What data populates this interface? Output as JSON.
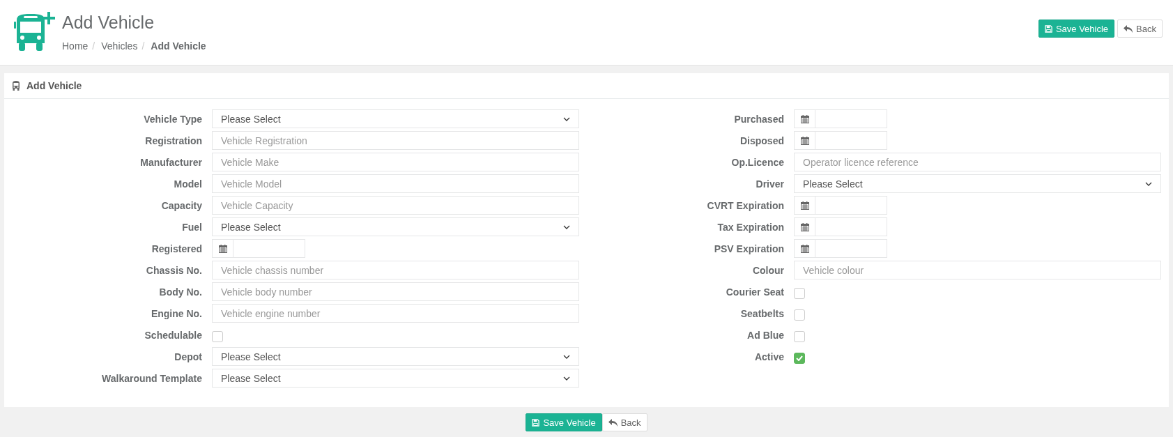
{
  "header": {
    "title": "Add Vehicle",
    "breadcrumbs": [
      {
        "label": "Home",
        "current": false
      },
      {
        "separator": "/",
        "label": "Vehicles",
        "current": false
      },
      {
        "separator": "/",
        "label": "Add Vehicle",
        "current": true
      }
    ],
    "buttons": [
      {
        "kind": "save",
        "label": "Save Vehicle"
      },
      {
        "kind": "back",
        "label": "Back"
      }
    ]
  },
  "panel": {
    "title": "Add Vehicle",
    "left_fields": [
      {
        "label": "Vehicle Type",
        "kind": "select",
        "value": "Please Select"
      },
      {
        "label": "Registration",
        "kind": "text",
        "placeholder": "Vehicle Registration"
      },
      {
        "label": "Manufacturer",
        "kind": "text",
        "placeholder": "Vehicle Make"
      },
      {
        "label": "Model",
        "kind": "text",
        "placeholder": "Vehicle Model"
      },
      {
        "label": "Capacity",
        "kind": "text",
        "placeholder": "Vehicle Capacity"
      },
      {
        "label": "Fuel",
        "kind": "select",
        "value": "Please Select"
      },
      {
        "label": "Registered",
        "kind": "date"
      },
      {
        "label": "Chassis No.",
        "kind": "text",
        "placeholder": "Vehicle chassis number"
      },
      {
        "label": "Body No.",
        "kind": "text",
        "placeholder": "Vehicle body number"
      },
      {
        "label": "Engine No.",
        "kind": "text",
        "placeholder": "Vehicle engine number"
      },
      {
        "label": "Schedulable",
        "kind": "checkbox",
        "checked": false
      },
      {
        "label": "Depot",
        "kind": "select",
        "value": "Please Select"
      },
      {
        "label": "Walkaround Template",
        "kind": "select",
        "value": "Please Select"
      }
    ],
    "right_fields": [
      {
        "label": "Purchased",
        "kind": "date"
      },
      {
        "label": "Disposed",
        "kind": "date"
      },
      {
        "label": "Op.Licence",
        "kind": "text",
        "placeholder": "Operator licence reference"
      },
      {
        "label": "Driver",
        "kind": "select",
        "value": "Please Select"
      },
      {
        "label": "CVRT Expiration",
        "kind": "date"
      },
      {
        "label": "Tax Expiration",
        "kind": "date"
      },
      {
        "label": "PSV Expiration",
        "kind": "date"
      },
      {
        "label": "Colour",
        "kind": "text",
        "placeholder": "Vehicle colour"
      },
      {
        "label": "Courier Seat",
        "kind": "checkbox",
        "checked": false
      },
      {
        "label": "Seatbelts",
        "kind": "checkbox",
        "checked": false
      },
      {
        "label": "Ad Blue",
        "kind": "checkbox",
        "checked": false
      },
      {
        "label": "Active",
        "kind": "checkbox",
        "checked": true
      }
    ]
  },
  "footer_buttons": [
    {
      "kind": "save",
      "label": "Save Vehicle"
    },
    {
      "kind": "back",
      "label": "Back"
    }
  ]
}
